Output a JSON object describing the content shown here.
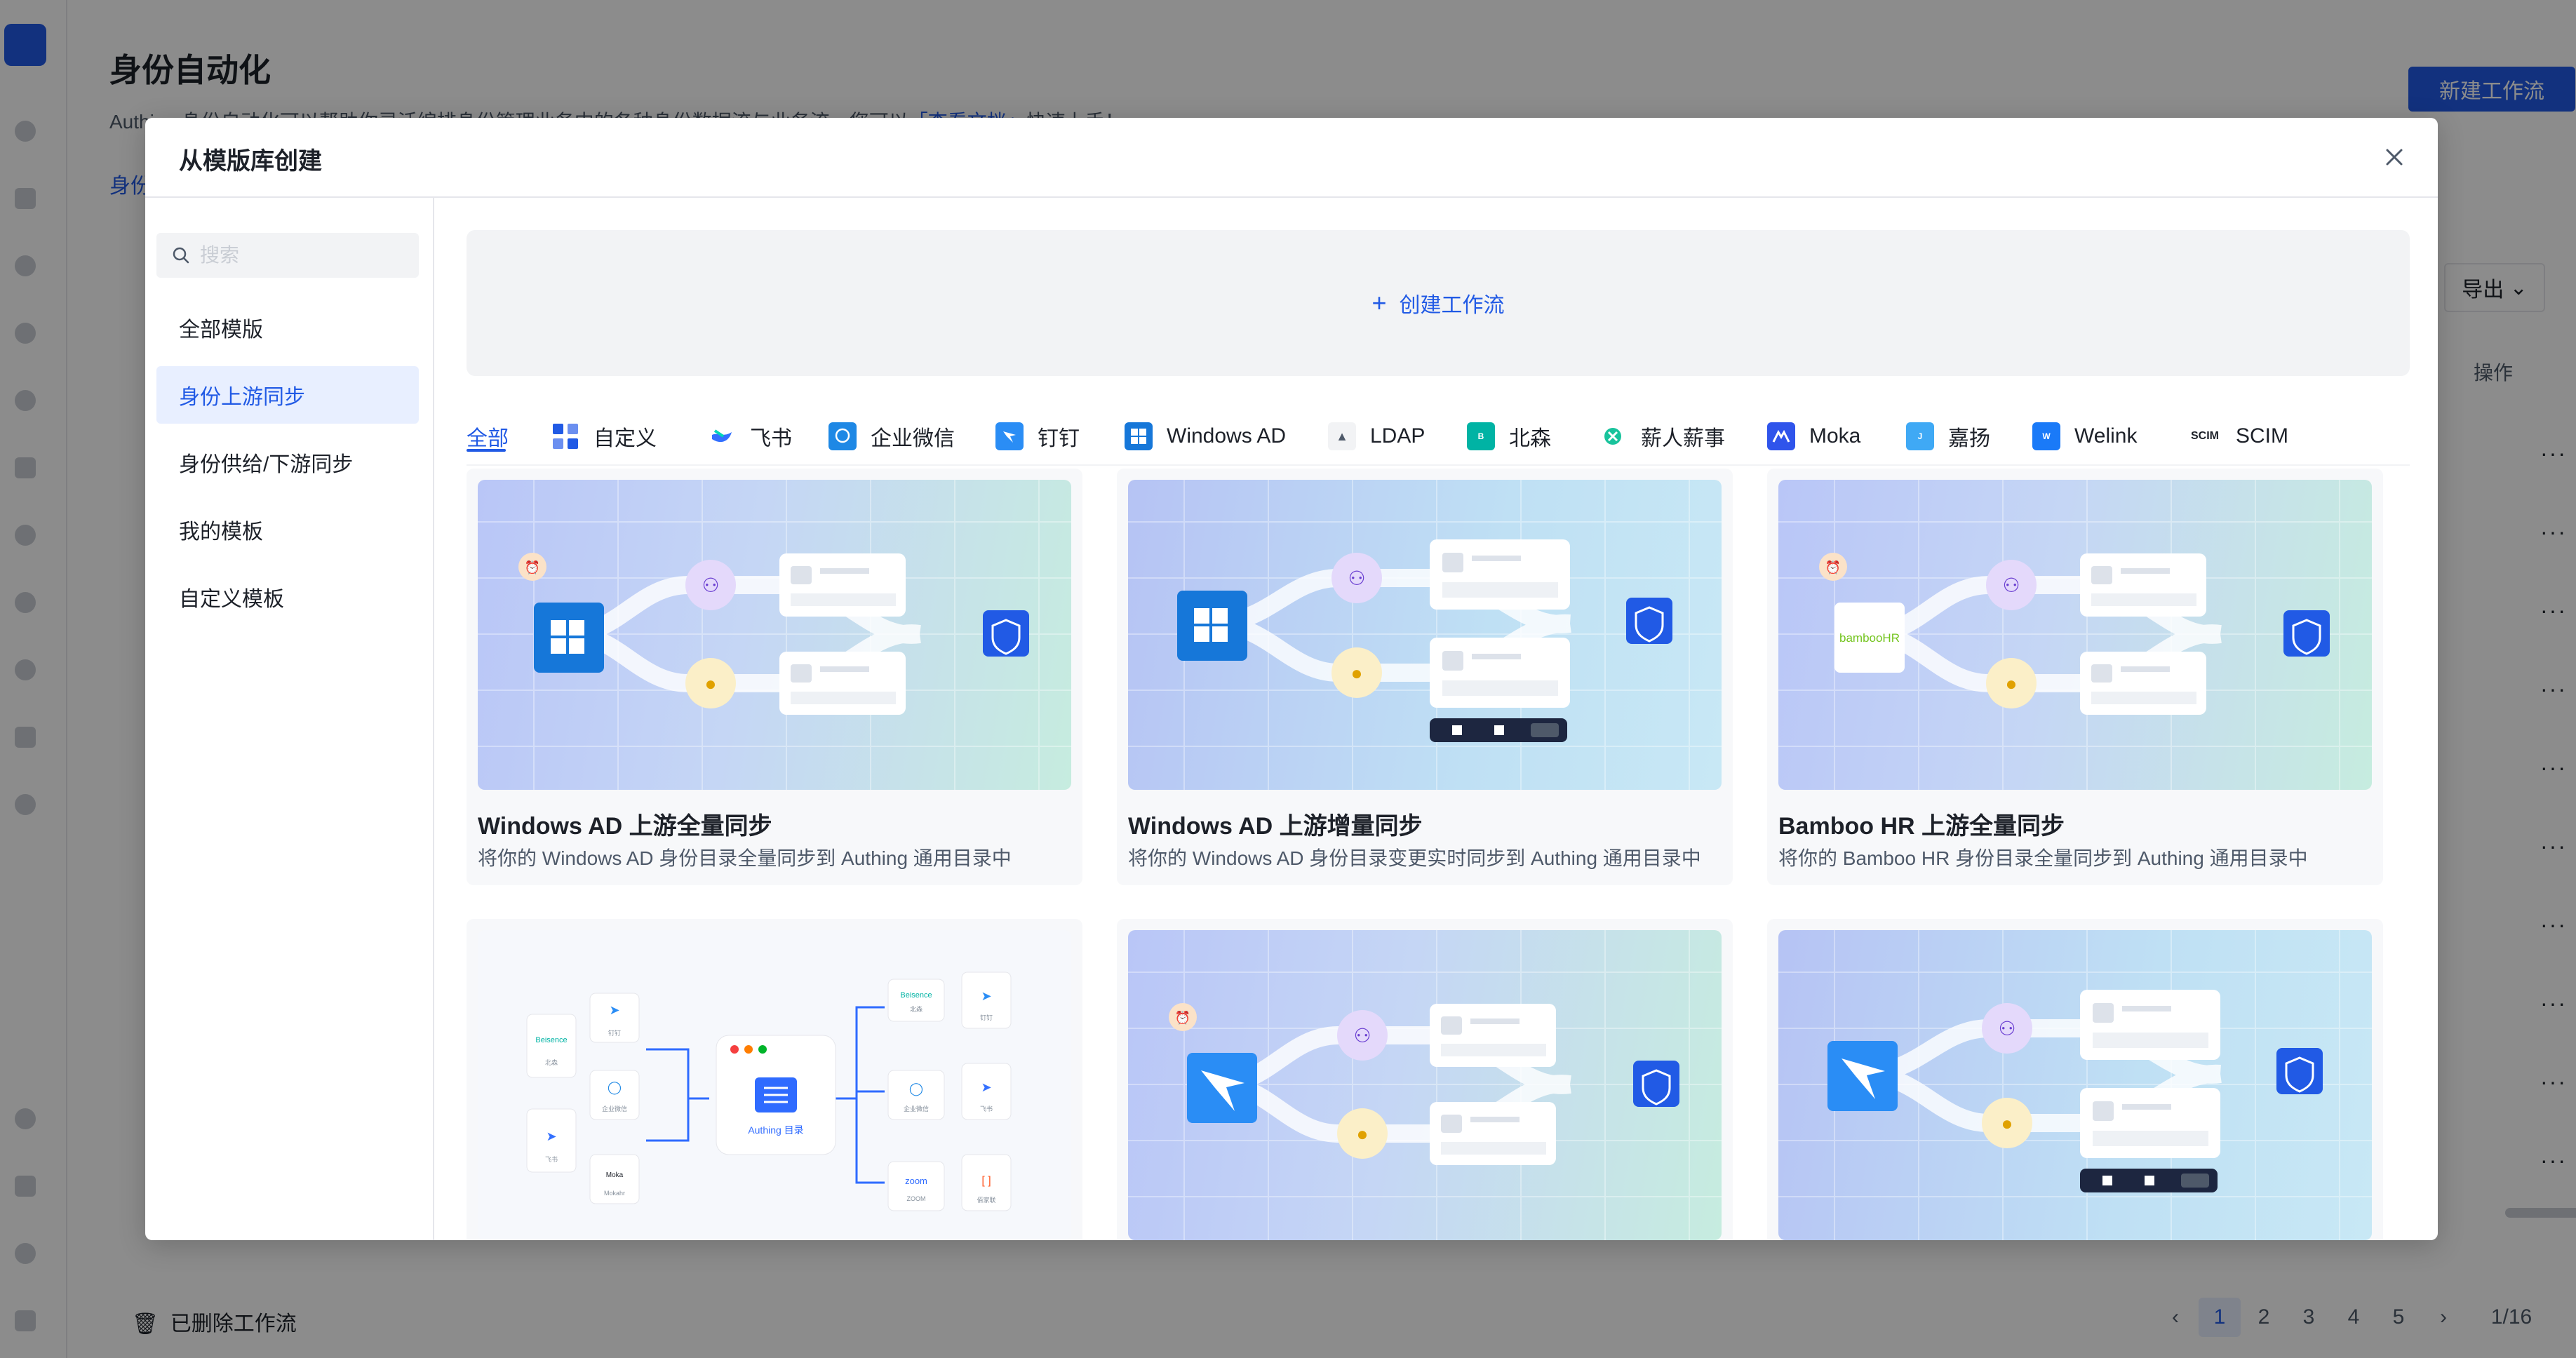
{
  "app": {
    "title": "身份自动化",
    "description_prefix": "Authing 身份自动化可以帮助你灵活编排身份管理业务中的各种身份数据流与业务流，您可以",
    "description_link": "「查看文档」",
    "description_suffix": "快速上手！",
    "new_workflow_button": "新建工作流",
    "tab_label": "身份",
    "export_button": "导出",
    "ops_header": "操作",
    "row_menu": "···",
    "deleted_workflows": "已删除工作流",
    "pagination": {
      "pages": [
        "1",
        "2",
        "3",
        "4",
        "5"
      ],
      "current": "1",
      "page_info": "1/16",
      "prev": "‹",
      "next": "›"
    }
  },
  "modal": {
    "title": "从模版库创建",
    "search_placeholder": "搜索",
    "menu": [
      {
        "label": "全部模版",
        "active": false
      },
      {
        "label": "身份上游同步",
        "active": true
      },
      {
        "label": "身份供给/下游同步",
        "active": false
      },
      {
        "label": "我的模板",
        "active": false
      },
      {
        "label": "自定义模板",
        "active": false
      }
    ],
    "create_button": "创建工作流",
    "filter_tabs": [
      {
        "label": "全部",
        "icon": "",
        "color": ""
      },
      {
        "label": "自定义",
        "icon": "grid-icon",
        "color": "#215ae5"
      },
      {
        "label": "飞书",
        "icon": "feishu-icon",
        "color": "#3370ff"
      },
      {
        "label": "企业微信",
        "icon": "wecom-icon",
        "color": "#1e88e5"
      },
      {
        "label": "钉钉",
        "icon": "dingtalk-icon",
        "color": "#2a8df5"
      },
      {
        "label": "Windows AD",
        "icon": "windows-icon",
        "color": "#1677d9"
      },
      {
        "label": "LDAP",
        "icon": "ldap-icon",
        "color": "#86909c"
      },
      {
        "label": "北森",
        "icon": "beisen-icon",
        "color": "#00b3a4"
      },
      {
        "label": "薪人薪事",
        "icon": "xinrenxinshi-icon",
        "color": "#19c39c"
      },
      {
        "label": "Moka",
        "icon": "moka-icon",
        "color": "#2f54eb"
      },
      {
        "label": "嘉扬",
        "icon": "jiayang-icon",
        "color": "#3fa9f5"
      },
      {
        "label": "Welink",
        "icon": "welink-icon",
        "color": "#1a7af8"
      },
      {
        "label": "SCIM",
        "icon": "scim-icon",
        "color": "#1d2129"
      }
    ],
    "more_tabs": "···",
    "cards": [
      {
        "title": "Windows AD 上游全量同步",
        "desc": "将你的 Windows AD 身份目录全量同步到 Authing 通用目录中",
        "source": "windows-icon"
      },
      {
        "title": "Windows AD 上游增量同步",
        "desc": "将你的 Windows AD 身份目录变更实时同步到 Authing 通用目录中",
        "source": "windows-icon"
      },
      {
        "title": "Bamboo HR 上游全量同步",
        "desc": "将你的 Bamboo HR 身份目录全量同步到 Authing 通用目录中",
        "source": "bamboohr-logo",
        "logo_text": "bambooHR"
      },
      {
        "title": "",
        "desc": "",
        "source": "authing-directory-diagram",
        "diagram": {
          "center_label": "Authing 目录",
          "left": [
            "Beisence",
            "北森",
            "钉钉",
            "企业微信",
            "飞书",
            "Moka",
            "Mokahr"
          ],
          "right": [
            "Beisence",
            "北森",
            "钉钉",
            "企业微信",
            "飞书",
            "zoom",
            "ZOOM",
            "佰家联"
          ]
        }
      },
      {
        "title": "",
        "desc": "",
        "source": "dingtalk-icon"
      },
      {
        "title": "",
        "desc": "",
        "source": "dingtalk-icon"
      }
    ]
  }
}
